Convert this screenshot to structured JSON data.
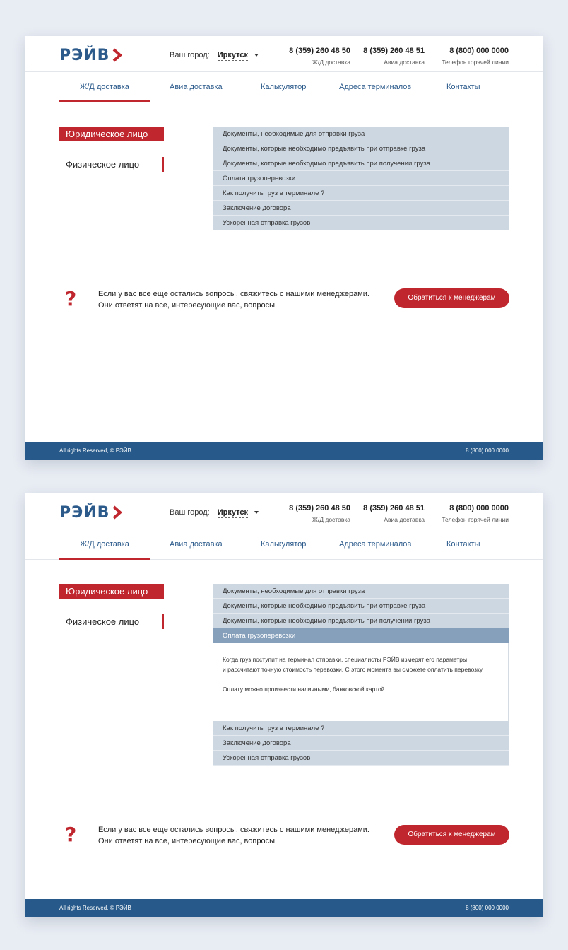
{
  "colors": {
    "brand_blue": "#2b5a8b",
    "accent_red": "#c0262d",
    "footer_blue": "#275a8a",
    "accordion_bg": "#cdd7e1",
    "accordion_open_bg": "#86a0bb"
  },
  "header": {
    "logo": "РЭЙВ",
    "city_label": "Ваш город:",
    "city_value": "Иркутск",
    "phones": [
      {
        "number": "8 (359) 260 48 50",
        "caption": "Ж/Д доставка"
      },
      {
        "number": "8 (359) 260 48 51",
        "caption": "Авиа доставка"
      },
      {
        "number": "8 (800) 000 0000",
        "caption": "Телефон горячей линии"
      }
    ]
  },
  "nav": {
    "items": [
      "Ж/Д доставка",
      "Авиа доставка",
      "Калькулятор",
      "Адреса терминалов",
      "Контакты"
    ],
    "active": "Ж/Д доставка"
  },
  "side_tabs": {
    "legal": "Юридическое лицо",
    "individual": "Физическое лицо",
    "active": "Юридическое лицо"
  },
  "accordion": {
    "items": [
      "Документы, необходимые для отправки груза",
      "Документы, которые необходимо предъявить при отправке груза",
      "Документы, которые необходимо предъявить при получении груза",
      "Оплата грузоперевозки",
      "Как получить груз в терминале ?",
      "Заключение договора",
      "Ускоренная отправка грузов"
    ],
    "expanded_item": "Оплата грузоперевозки",
    "expanded_text": {
      "line1": "Когда груз поступит на терминал отправки, специалисты РЭЙВ измерят его параметры",
      "line2": "и рассчитают точную стоимость перевозки. С этого момента вы сможете оплатить перевозку.",
      "line3": "Оплату можно произвести наличными, банковской картой."
    }
  },
  "question": {
    "mark": "?",
    "line1": "Если у вас все еще остались вопросы, свяжитесь с нашими менеджерами.",
    "line2": "Они ответят на все, интересующие вас, вопросы.",
    "button": "Обратиться к менеджерам"
  },
  "footer": {
    "copyright": "All rights Reserved, © РЭЙВ",
    "phone": "8 (800) 000 0000"
  }
}
